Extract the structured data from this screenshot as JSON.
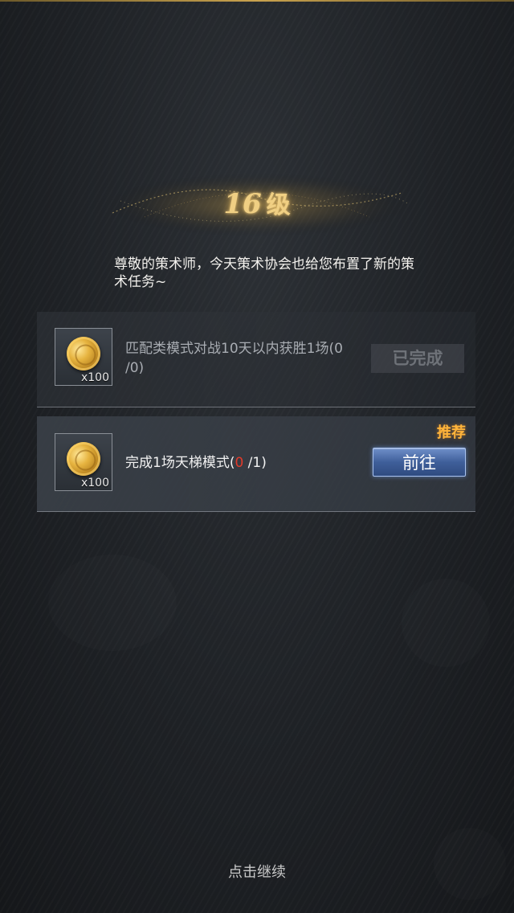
{
  "level": {
    "number": "16",
    "unit": "级"
  },
  "intro_text": "尊敬的策术师，今天策术协会也给您布置了新的策术任务~",
  "tasks": [
    {
      "reward_qty": "x100",
      "text": "匹配类模式对战10天以内获胜1场(0 /0)",
      "button_label": "已完成",
      "status": "completed"
    },
    {
      "reward_qty": "x100",
      "text_prefix": "完成1场天梯模式(",
      "progress_current": "0",
      "text_suffix": " /1)",
      "button_label": "前往",
      "tag": "推荐",
      "status": "in-progress"
    }
  ],
  "continue_label": "点击继续",
  "colors": {
    "gold": "#f0cf83",
    "recommend": "#ffb43a",
    "progress_red": "#e33a2a",
    "go_button": "#3f5f9a"
  },
  "icons": {
    "reward": "gold-coin-icon"
  }
}
